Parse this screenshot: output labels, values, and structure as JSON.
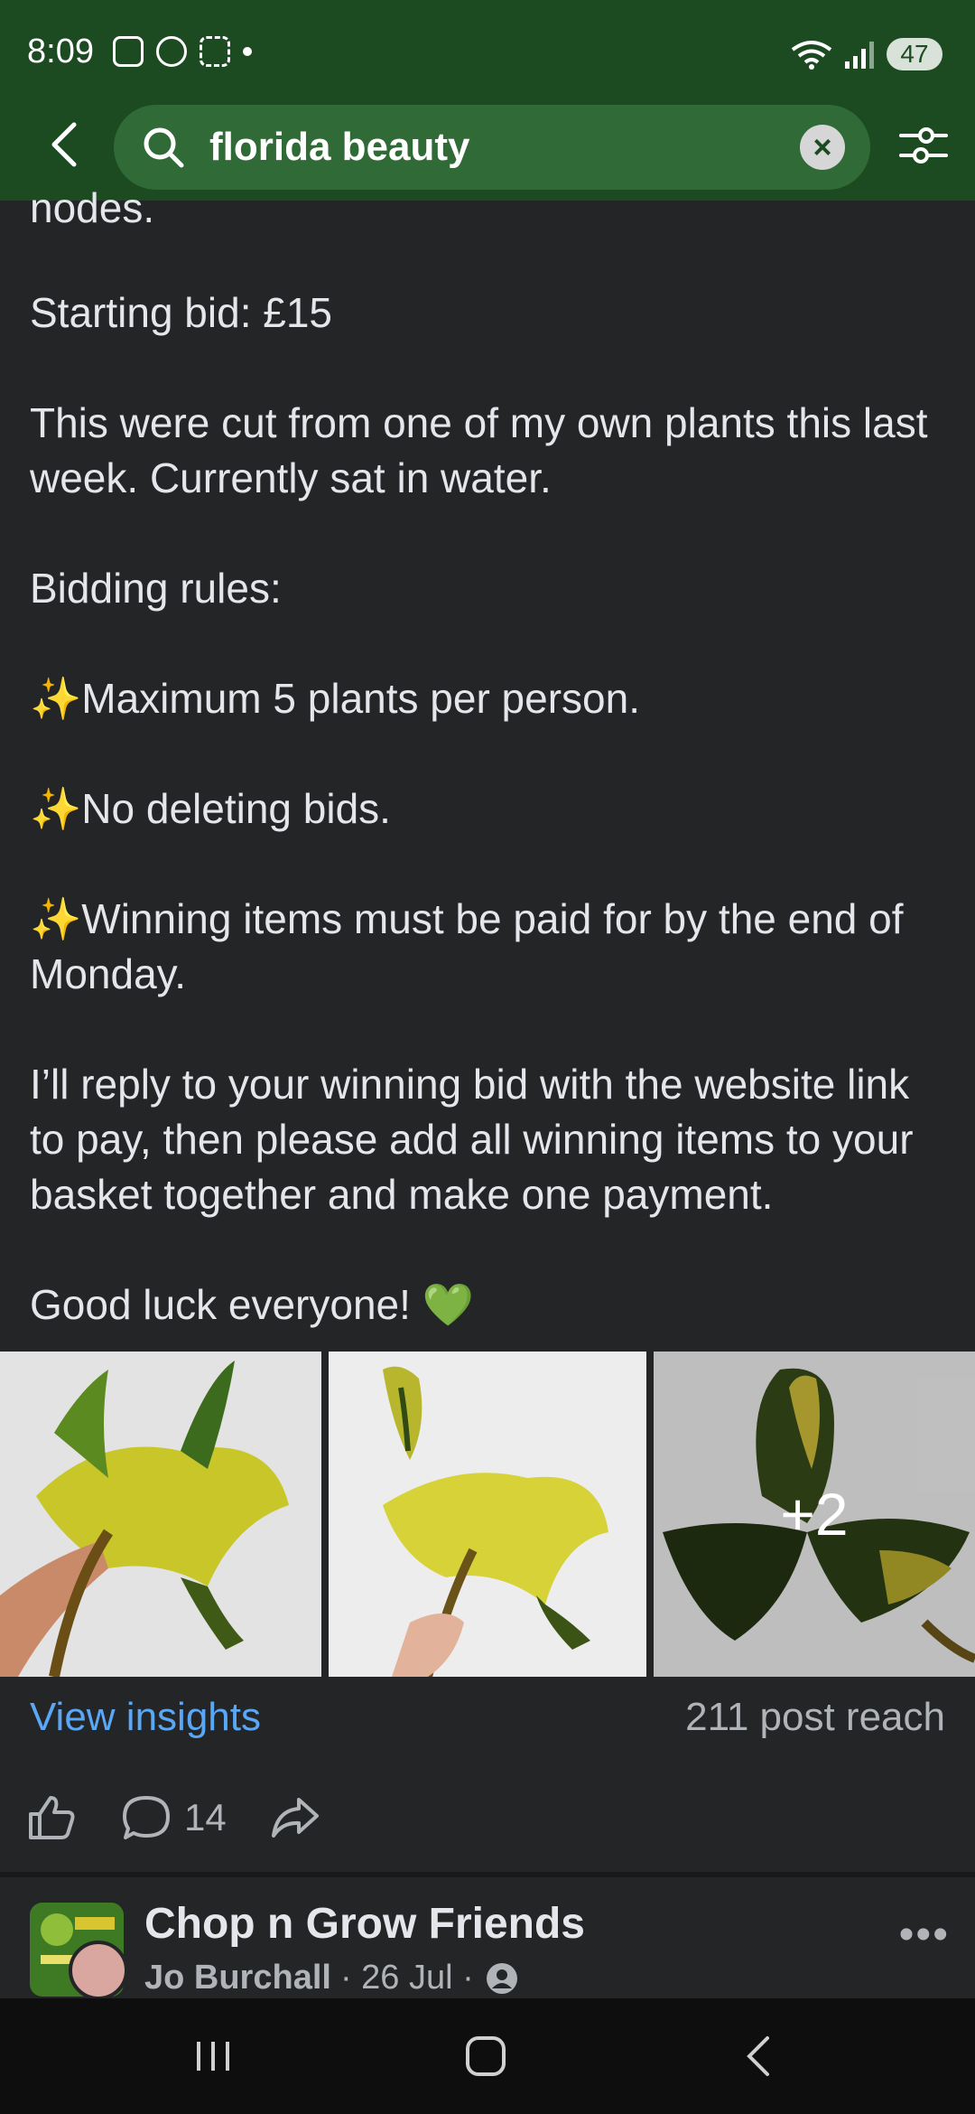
{
  "status_bar": {
    "time": "8:09",
    "battery": "47",
    "icons": [
      "shopping-bag-icon",
      "messenger-icon",
      "screenshot-icon",
      "dot-icon",
      "wifi-icon",
      "signal-icon",
      "battery-icon"
    ]
  },
  "search": {
    "query": "florida beauty"
  },
  "post": {
    "truncated_line": "nodes.",
    "starting_bid": "Starting bid: £15",
    "paragraph_cut": "This were cut from one of my own plants this last week. Currently sat in water.",
    "rules_heading": "Bidding rules:",
    "rule_1": "✨Maximum 5 plants per person.",
    "rule_2": "✨No deleting bids.",
    "rule_3": "✨Winning items must be paid for by the end of Monday.",
    "payment": "I’ll reply to your winning bid with the website link to pay, then please add all winning items to your basket together and make one payment.",
    "sign_off": "Good luck everyone! 💚",
    "photos": {
      "more_count": "+2"
    },
    "view_insights": "View insights",
    "reach": "211 post reach",
    "comment_count": "14"
  },
  "next_post": {
    "group_name": "Chop n Grow Friends",
    "author": "Jo Burchall",
    "date": "· 26 Jul ·"
  },
  "colors": {
    "header_green": "#1c4b22",
    "search_green": "#306a36",
    "background": "#242526",
    "link_blue": "#5aa7f5"
  }
}
